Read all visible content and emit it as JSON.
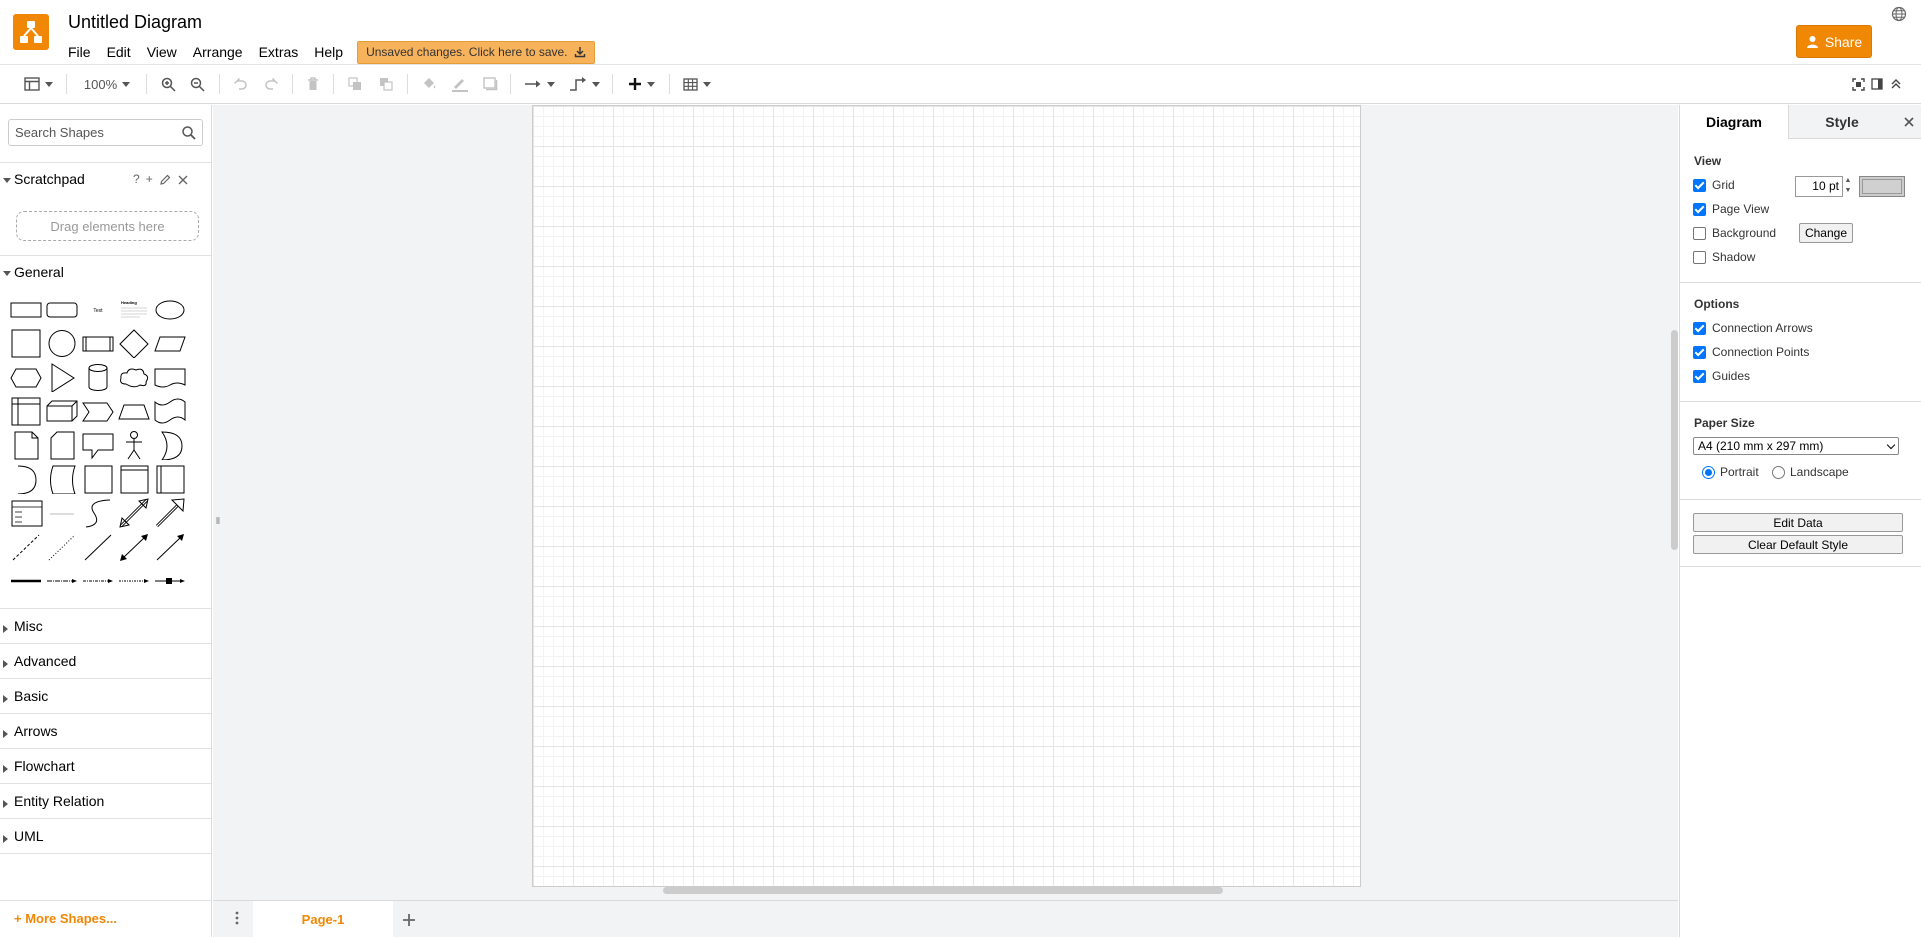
{
  "header": {
    "title": "Untitled Diagram",
    "menus": [
      "File",
      "Edit",
      "View",
      "Arrange",
      "Extras",
      "Help"
    ],
    "unsaved_label": "Unsaved changes. Click here to save.",
    "share_label": "Share"
  },
  "toolbar": {
    "zoom": "100%"
  },
  "sidebar": {
    "search_placeholder": "Search Shapes",
    "scratchpad": {
      "title": "Scratchpad",
      "help": "?",
      "add": "+",
      "drop_hint": "Drag elements here"
    },
    "general_title": "General",
    "shape_text": {
      "text": "Text",
      "heading": "Heading"
    },
    "collapsed_sections": [
      "Misc",
      "Advanced",
      "Basic",
      "Arrows",
      "Flowchart",
      "Entity Relation",
      "UML"
    ],
    "more_shapes": "+ More Shapes..."
  },
  "pages": {
    "tabs": [
      "Page-1"
    ]
  },
  "format_panel": {
    "tabs": [
      "Diagram",
      "Style"
    ],
    "view": {
      "heading": "View",
      "grid": "Grid",
      "grid_size": "10 pt",
      "grid_color": "#d0d0d0",
      "page_view": "Page View",
      "background": "Background",
      "change": "Change",
      "shadow": "Shadow"
    },
    "options": {
      "heading": "Options",
      "connection_arrows": "Connection Arrows",
      "connection_points": "Connection Points",
      "guides": "Guides"
    },
    "paper": {
      "heading": "Paper Size",
      "selected": "A4 (210 mm x 297 mm)",
      "portrait": "Portrait",
      "landscape": "Landscape"
    },
    "edit_data": "Edit Data",
    "clear_default_style": "Clear Default Style"
  },
  "colors": {
    "accent": "#f08705",
    "checkbox": "#0075ff"
  }
}
